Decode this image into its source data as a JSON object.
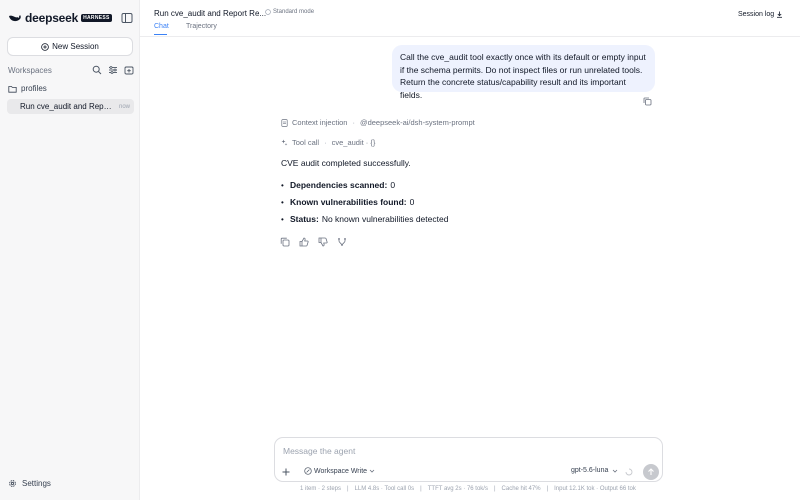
{
  "sidebar": {
    "brand_name": "deepseek",
    "brand_badge": "HARNESS",
    "new_session_label": "New Session",
    "workspaces_label": "Workspaces",
    "profile_label": "profiles",
    "session": {
      "title": "Run cve_audit and Report Re...",
      "time": "now"
    },
    "settings_label": "Settings"
  },
  "header": {
    "title": "Run cve_audit and Report Re...",
    "mode": "Standard mode",
    "tabs": [
      {
        "label": "Chat"
      },
      {
        "label": "Trajectory"
      }
    ],
    "session_log_label": "Session log"
  },
  "chat": {
    "user_message": "Call the cve_audit tool exactly once with its default or empty input if the schema permits. Do not inspect files or run unrelated tools. Return the concrete status/capability result and its important fields.",
    "context_label": "Context injection",
    "context_value": "@deepseek-ai/dsh-system-prompt",
    "tool_label": "Tool call",
    "tool_value": "cve_audit · {}",
    "response_intro": "CVE audit completed successfully.",
    "bullets": [
      {
        "key": "Dependencies scanned:",
        "value": "0"
      },
      {
        "key": "Known vulnerabilities found:",
        "value": "0"
      },
      {
        "key": "Status:",
        "value": "No known vulnerabilities detected"
      }
    ]
  },
  "composer": {
    "placeholder": "Message the agent",
    "workspace_mode": "Workspace Write",
    "model": "gpt-5.6-luna"
  },
  "status_bar": [
    "1 item · 2 steps",
    "LLM 4.8s · Tool call 0s",
    "TTFT avg 2s · 76 tok/s",
    "Cache hit 47%",
    "Input 12.1K tok · Output 66 tok"
  ],
  "colors": {
    "accent": "#3b82f6",
    "user_bubble": "#eef2fe",
    "sidebar_bg": "#f7f7f8"
  }
}
